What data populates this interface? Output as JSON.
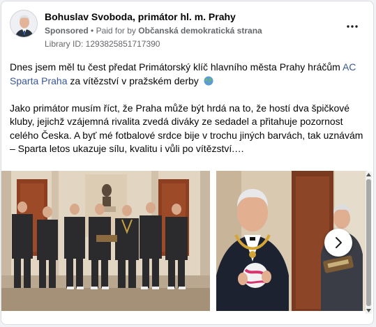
{
  "ad": {
    "page_name": "Bohuslav Svoboda, primátor hl. m. Prahy",
    "sponsored": "Sponsored",
    "separator": "•",
    "paid_for_prefix": "Paid for by",
    "payer": "Občanská demokratická strana",
    "library_id": "Library ID: 1293825851717390"
  },
  "post": {
    "p1_before": "Dnes jsem měl tu čest předat Primátorský klíč hlavního města Prahy hráčům ",
    "p1_link": "AC Sparta Praha",
    "p1_after": " za vítězství v pražském derby ",
    "p2": "Jako primátor musím říct, že Praha může být hrdá na to, že hostí dva špičkové kluby, jejichž vzájemná rivalita zvedá diváky ze sedadel a přitahuje pozornost celého Česka. A byť mé fotbalové srdce bije v trochu jiných barvách, tak uznávám – Sparta letos ukazuje sílu, kvalitu i vůli po vítězství.…"
  },
  "icons": {
    "more": "more-horizontal-icon",
    "globe": "globe-emoji-icon",
    "next": "chevron-right-icon"
  },
  "colors": {
    "link": "#385898",
    "meta": "#65676b",
    "text": "#050505"
  }
}
